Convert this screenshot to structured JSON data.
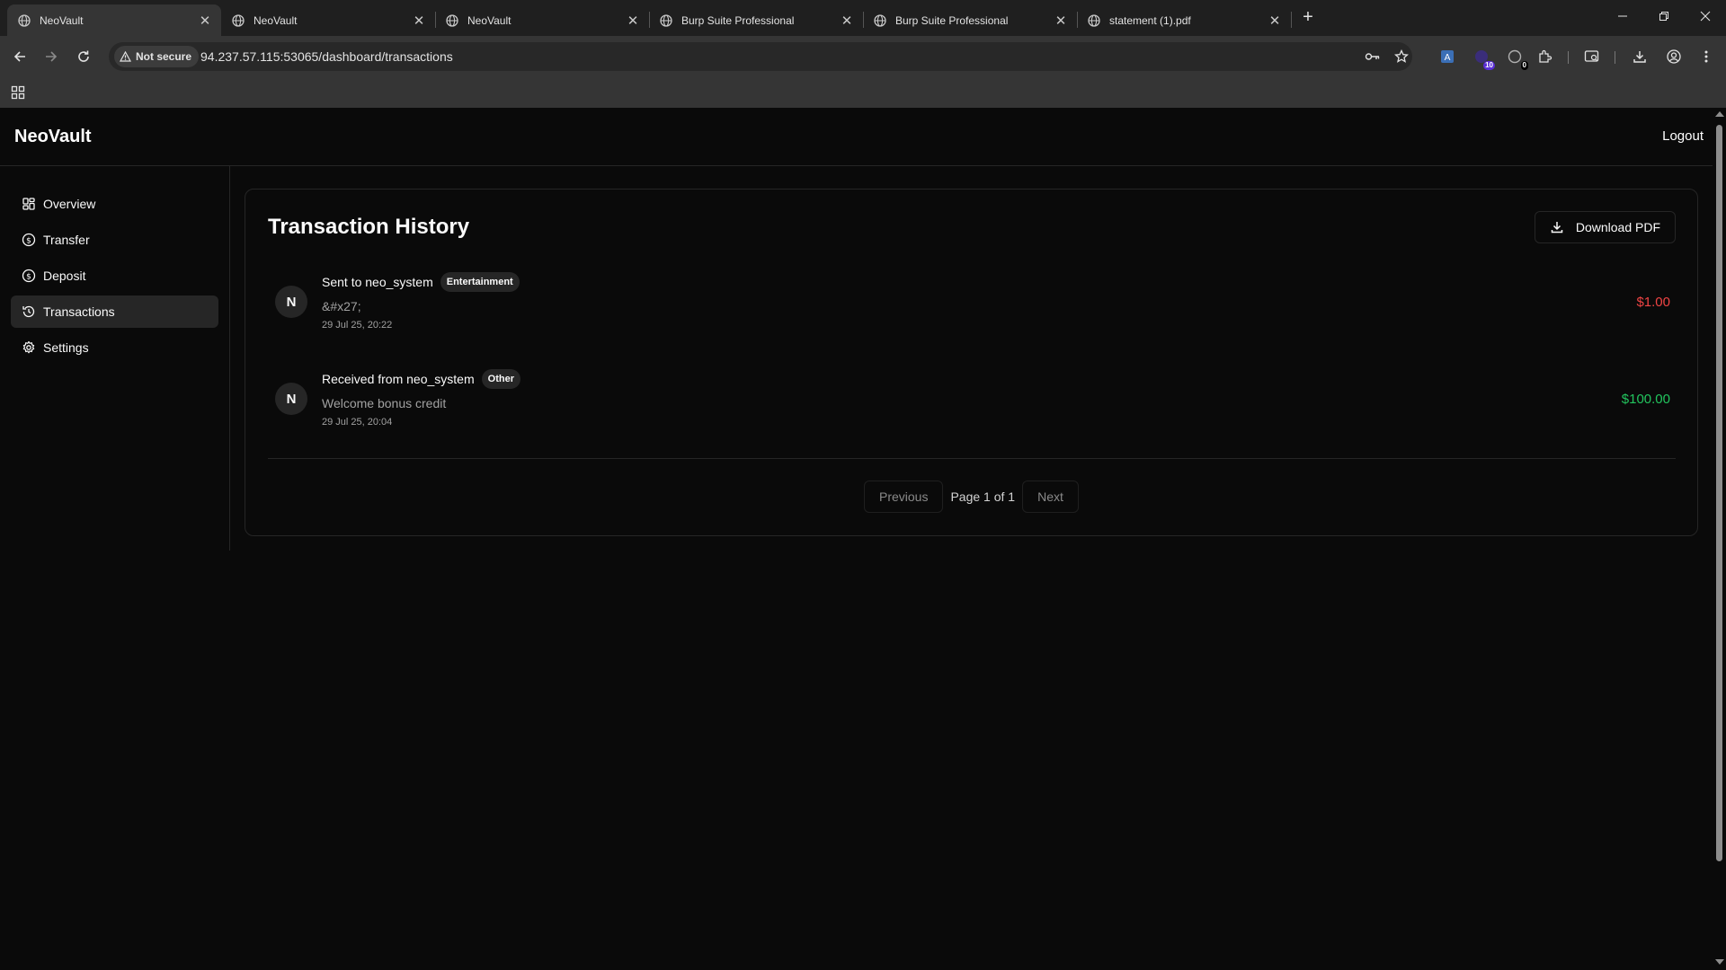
{
  "browser": {
    "tabs": [
      {
        "title": "NeoVault",
        "active": true
      },
      {
        "title": "NeoVault",
        "active": false
      },
      {
        "title": "NeoVault",
        "active": false
      },
      {
        "title": "Burp Suite Professional",
        "active": false
      },
      {
        "title": "Burp Suite Professional",
        "active": false
      },
      {
        "title": "statement (1).pdf",
        "active": false
      }
    ],
    "security_label": "Not secure",
    "url": "94.237.57.115:53065/dashboard/transactions",
    "extension_badges": [
      "10",
      "0"
    ]
  },
  "app": {
    "brand": "NeoVault",
    "logout_label": "Logout",
    "nav": [
      {
        "label": "Overview",
        "icon": "layout-grid-icon",
        "active": false
      },
      {
        "label": "Transfer",
        "icon": "dollar-circle-icon",
        "active": false
      },
      {
        "label": "Deposit",
        "icon": "dollar-circle-icon",
        "active": false
      },
      {
        "label": "Transactions",
        "icon": "history-icon",
        "active": true
      },
      {
        "label": "Settings",
        "icon": "gear-icon",
        "active": false
      }
    ]
  },
  "transactions": {
    "title": "Transaction History",
    "download_label": "Download PDF",
    "items": [
      {
        "avatar": "N",
        "title": "Sent to neo_system",
        "category": "Entertainment",
        "description": "&#x27;",
        "date": "29 Jul 25, 20:22",
        "amount": "$1.00",
        "direction": "out"
      },
      {
        "avatar": "N",
        "title": "Received from neo_system",
        "category": "Other",
        "description": "Welcome bonus credit",
        "date": "29 Jul 25, 20:04",
        "amount": "$100.00",
        "direction": "in"
      }
    ],
    "pagination": {
      "previous_label": "Previous",
      "info": "Page 1 of 1",
      "next_label": "Next"
    }
  },
  "colors": {
    "negative": "#ef4444",
    "positive": "#22c55e",
    "background": "#0a0a0a",
    "border": "#262626"
  }
}
